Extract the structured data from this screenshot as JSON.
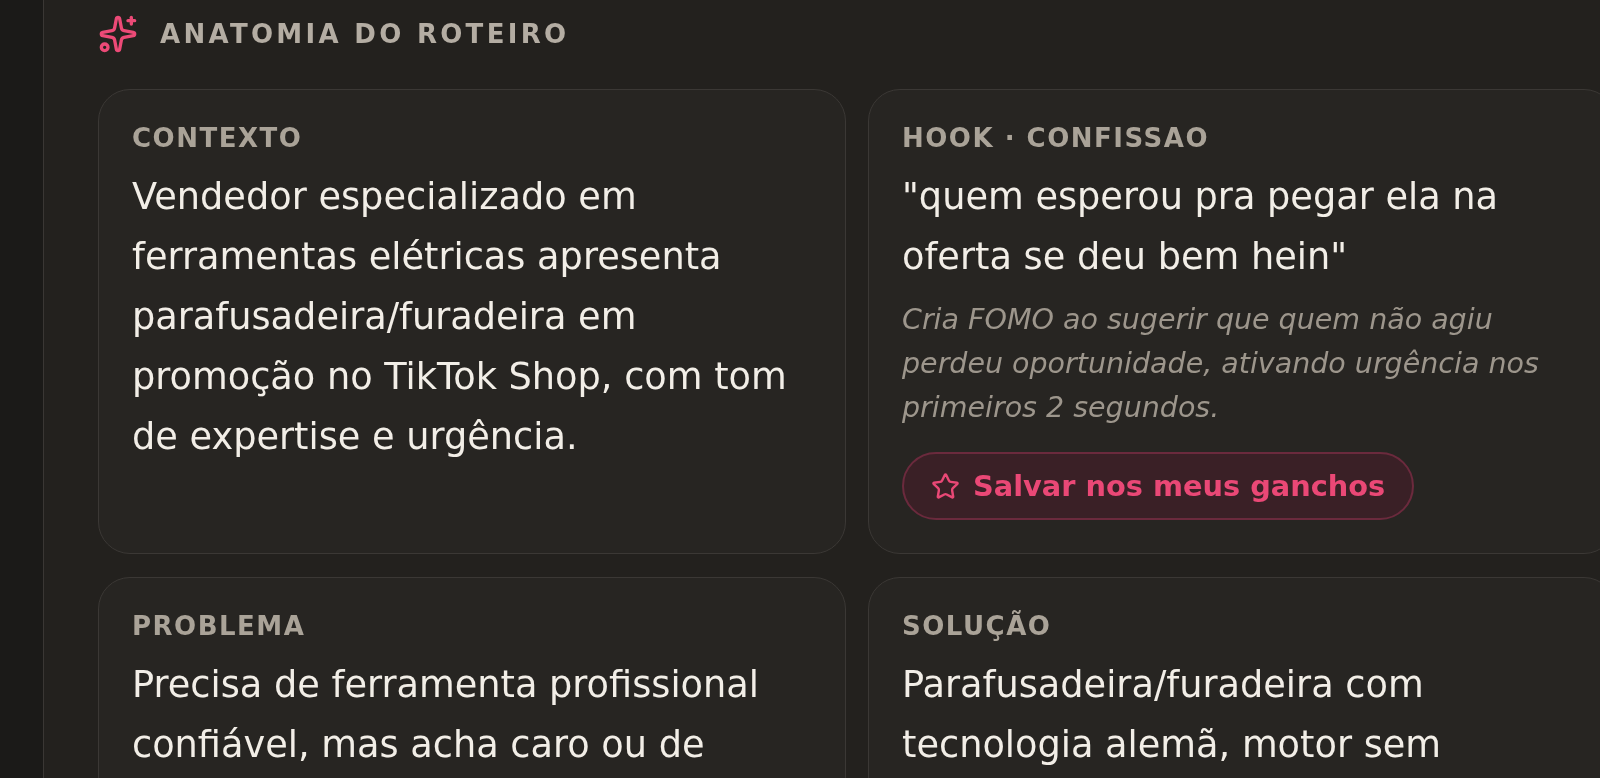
{
  "header": {
    "title": "ANATOMIA DO ROTEIRO"
  },
  "sections": [
    {
      "kind": "summary",
      "label": "CONTEXTO",
      "text": "Vendedor especializado em ferramentas elétricas apresenta parafusadeira/furadeira em promoção no TikTok Shop, com tom de expertise e urgência."
    },
    {
      "kind": "hook",
      "label": "HOOK · CONFISSAO",
      "text": "\"quem esperou pra pegar ela na oferta se deu bem hein\"",
      "note": "Cria FOMO ao sugerir que quem não agiu perdeu oportunidade, ativando urgência nos primeiros 2 segundos.",
      "save_button": {
        "label": "Salvar nos meus ganchos"
      }
    },
    {
      "kind": "summary",
      "label": "PROBLEMA",
      "text": "Precisa de ferramenta profissional confiável, mas acha caro ou de"
    },
    {
      "kind": "summary",
      "label": "SOLUÇÃO",
      "text": "Parafusadeira/furadeira com tecnologia alemã, motor sem"
    }
  ]
}
